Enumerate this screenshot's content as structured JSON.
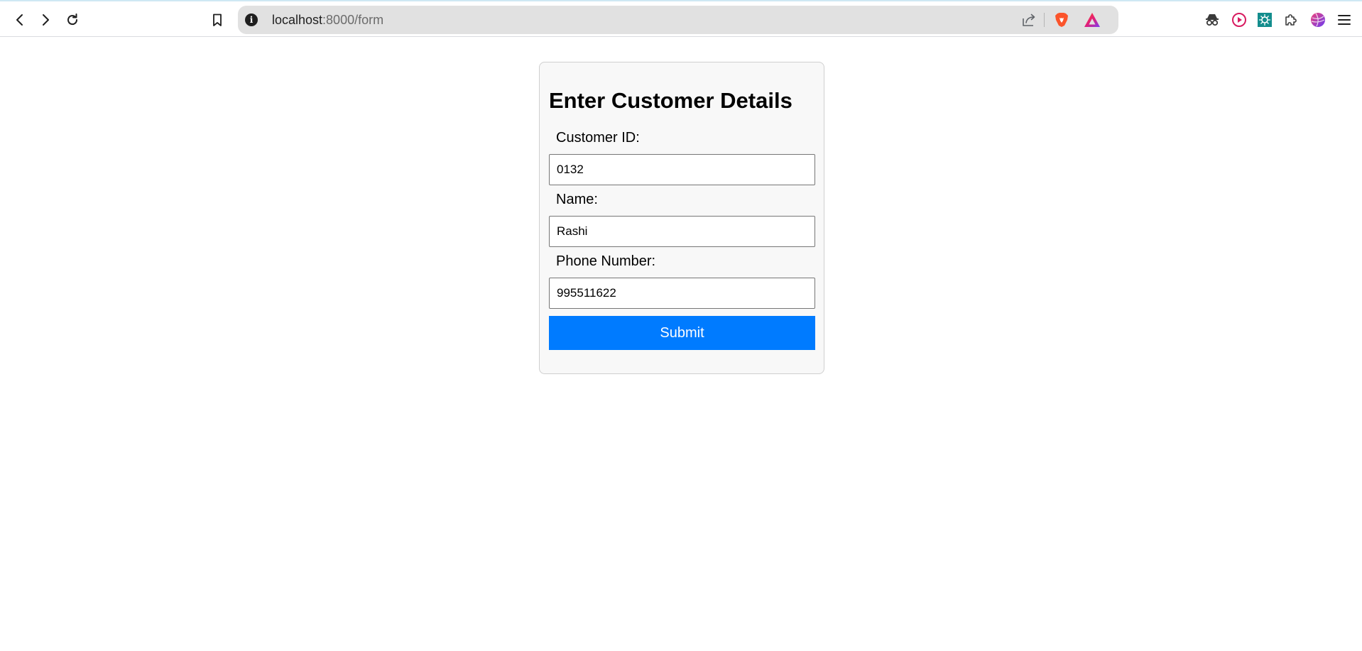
{
  "browser": {
    "url_host": "localhost",
    "url_path": ":8000/form",
    "icons": {
      "back": "chevron-left-icon",
      "forward": "chevron-right-icon",
      "reload": "reload-icon",
      "bookmark": "bookmark-icon",
      "site_info": "info-icon",
      "share": "share-icon",
      "brave_shields": "brave-lion-icon",
      "brave_rewards": "triangle-icon",
      "extensions": [
        "spy-mask-icon",
        "play-circle-icon",
        "gear-teal-icon",
        "puzzle-piece-icon",
        "globe-ball-icon"
      ],
      "menu": "hamburger-menu-icon"
    },
    "colors": {
      "address_bar_bg": "#e1e1e1",
      "brave_orange": "#fb542b",
      "rewards_purple": "#7b3ff2"
    }
  },
  "form": {
    "title": "Enter Customer Details",
    "fields": [
      {
        "label": "Customer ID:",
        "value": "0132"
      },
      {
        "label": "Name:",
        "value": "Rashi"
      },
      {
        "label": "Phone Number:",
        "value": "995511622"
      }
    ],
    "submit_label": "Submit",
    "colors": {
      "submit_bg": "#007bff",
      "card_bg": "#f8f8f8"
    }
  }
}
